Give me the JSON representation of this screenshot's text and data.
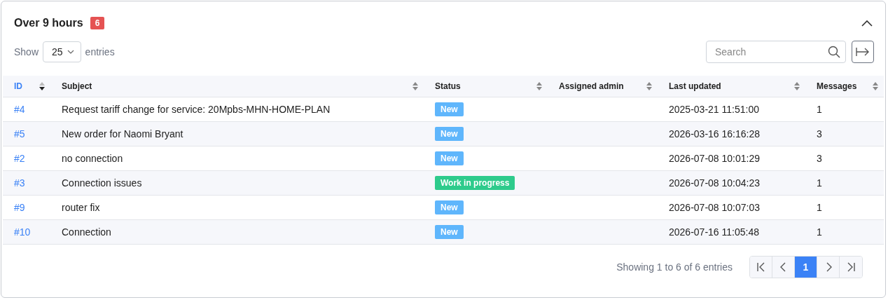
{
  "panel": {
    "title": "Over 9 hours",
    "count": "6",
    "expanded": true
  },
  "length_menu": {
    "before": "Show",
    "value": "25",
    "after": "entries"
  },
  "search": {
    "placeholder": "Search"
  },
  "table": {
    "columns": [
      {
        "label": "ID",
        "sorted": true
      },
      {
        "label": "Subject",
        "sorted": false
      },
      {
        "label": "Status",
        "sorted": false
      },
      {
        "label": "Assigned admin",
        "sorted": false
      },
      {
        "label": "Last updated",
        "sorted": false
      },
      {
        "label": "Messages",
        "sorted": false
      }
    ],
    "rows": [
      {
        "id": "#4",
        "subject": "Request tariff change for service: 20Mpbs-MHN-HOME-PLAN",
        "status": {
          "text": "New",
          "color": "#5fb6fc"
        },
        "last_updated": "2025-03-21 11:51:00",
        "messages": "1"
      },
      {
        "id": "#5",
        "subject": "New order for Naomi Bryant",
        "status": {
          "text": "New",
          "color": "#5fb6fc"
        },
        "last_updated": "2026-03-16 16:16:28",
        "messages": "3"
      },
      {
        "id": "#2",
        "subject": "no connection",
        "status": {
          "text": "New",
          "color": "#5fb6fc"
        },
        "last_updated": "2026-07-08 10:01:29",
        "messages": "3"
      },
      {
        "id": "#3",
        "subject": "Connection issues",
        "status": {
          "text": "Work in progress",
          "color": "#2ecb8c"
        },
        "last_updated": "2026-07-08 10:04:23",
        "messages": "1"
      },
      {
        "id": "#9",
        "subject": "router fix",
        "status": {
          "text": "New",
          "color": "#5fb6fc"
        },
        "last_updated": "2026-07-08 10:07:03",
        "messages": "1"
      },
      {
        "id": "#10",
        "subject": "Connection",
        "status": {
          "text": "New",
          "color": "#5fb6fc"
        },
        "last_updated": "2026-07-16 11:05:48",
        "messages": "1"
      }
    ]
  },
  "info": "Showing 1 to 6 of 6 entries",
  "pagination": {
    "pages": [
      {
        "label": "1",
        "selected": true
      }
    ]
  }
}
